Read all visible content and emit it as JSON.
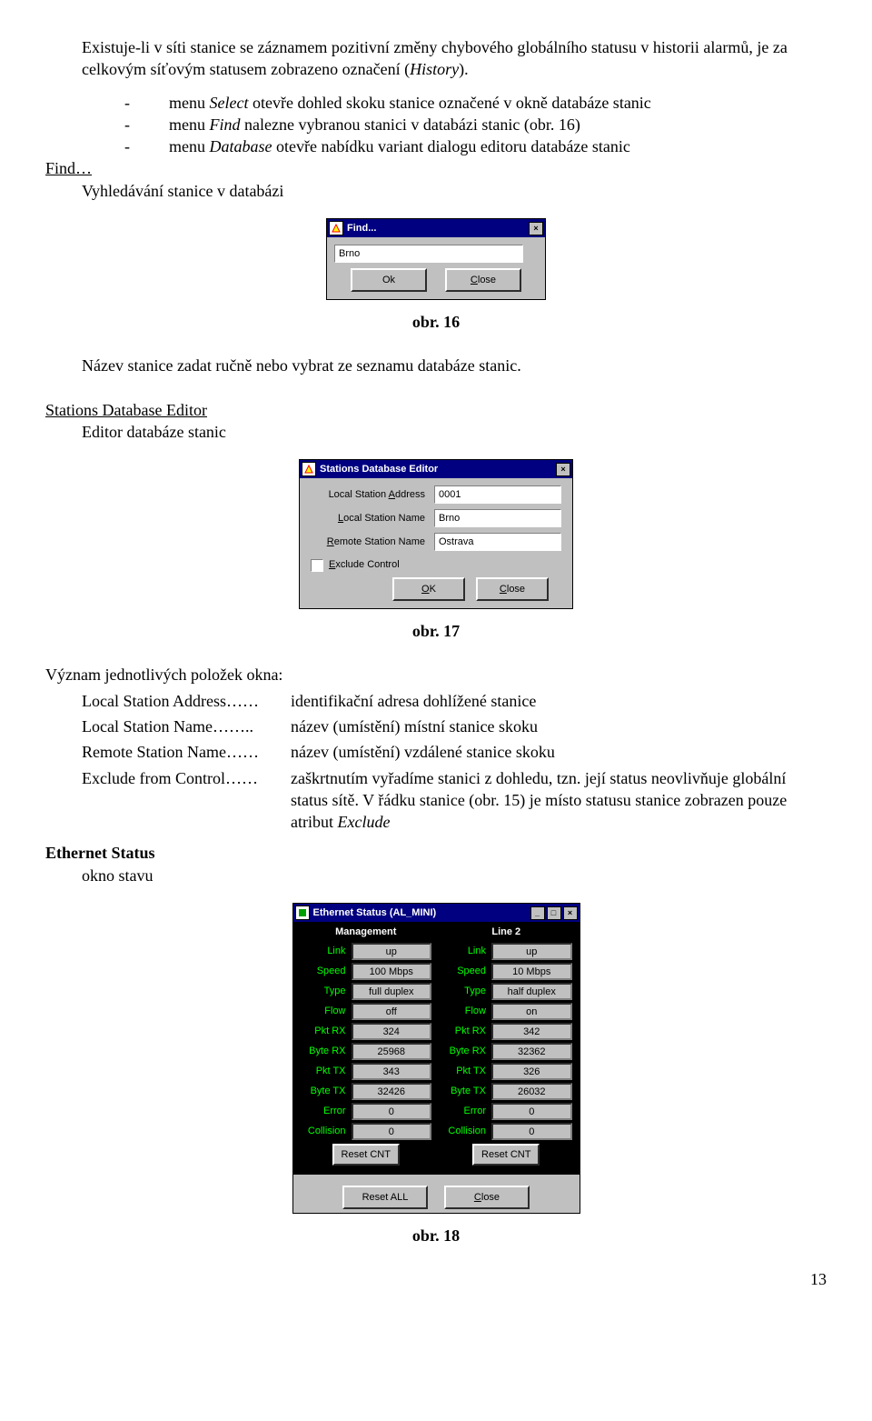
{
  "para1_a": "Existuje-li v síti stanice se záznamem pozitivní změny chybového globálního statusu v historii alarmů, je za celkovým síťovým statusem zobrazeno označení (",
  "para1_b": "History",
  "para1_c": ").",
  "bullets": {
    "sel_a": "menu ",
    "sel_i": "Select",
    "sel_b": " otevře dohled skoku stanice označené v okně databáze stanic",
    "find_a": "menu ",
    "find_i": "Find",
    "find_b": " nalezne vybranou stanici v databázi stanic (obr. 16)",
    "db_a": "menu ",
    "db_i": "Database",
    "db_b": " otevře nabídku variant dialogu editoru databáze stanic"
  },
  "find_heading": "Find…",
  "find_sub": "Vyhledávání stanice v databázi",
  "findDialog": {
    "title": "Find...",
    "value": "Brno",
    "ok": "Ok",
    "close": "Close",
    "close_u": "C"
  },
  "cap16": "obr. 16",
  "afterFind": "Název stanice zadat ručně nebo vybrat ze seznamu databáze stanic.",
  "sdeHeading": "Stations Database Editor",
  "sdeSub": "Editor databáze stanic",
  "sde": {
    "title": "Stations Database Editor",
    "f1": "Local Station Address",
    "v1": "0001",
    "f2": "Local Station Name",
    "v2": "Brno",
    "f3": "Remote Station Name",
    "v3": "Ostrava",
    "f4": "Exclude Control",
    "ok": "OK",
    "ok_u": "O",
    "close": "Close",
    "close_u": "C",
    "lblL": "L",
    "lblE": "E",
    "lblR": "R"
  },
  "cap17": "obr. 17",
  "meaningTitle": "Význam jednotlivých položek okna:",
  "meaning": {
    "r1l": "Local Station Address……",
    "r1v": "identifikační adresa dohlížené stanice",
    "r2l": "Local Station Name……..",
    "r2v": "název (umístění) místní stanice skoku",
    "r3l": "Remote Station Name……",
    "r3v": "název (umístění) vzdálené stanice skoku",
    "r4l": "Exclude from Control……",
    "r4va": "zaškrtnutím vyřadíme stanici z dohledu, tzn. její status neovlivňuje globální status sítě. V řádku stanice (obr. 15) je místo statusu stanice zobrazen pouze atribut ",
    "r4vb": "Exclude"
  },
  "ethHeading": "Ethernet Status",
  "ethSub": "okno stavu",
  "eth": {
    "title": "Ethernet Status (AL_MINI)",
    "col1": "Management",
    "col2": "Line 2",
    "labels": {
      "link": "Link",
      "speed": "Speed",
      "type": "Type",
      "flow": "Flow",
      "pktrx": "Pkt RX",
      "byterx": "Byte RX",
      "pkttx": "Pkt TX",
      "bytetx": "Byte TX",
      "error": "Error",
      "coll": "Collision"
    },
    "c1": {
      "link": "up",
      "speed": "100 Mbps",
      "type": "full duplex",
      "flow": "off",
      "pktrx": "324",
      "byterx": "25968",
      "pkttx": "343",
      "bytetx": "32426",
      "error": "0",
      "coll": "0"
    },
    "c2": {
      "link": "up",
      "speed": "10 Mbps",
      "type": "half duplex",
      "flow": "on",
      "pktrx": "342",
      "byterx": "32362",
      "pkttx": "326",
      "bytetx": "26032",
      "error": "0",
      "coll": "0"
    },
    "resetcnt": "Reset CNT",
    "resetall": "Reset ALL",
    "close": "Close",
    "close_u": "C"
  },
  "cap18": "obr. 18",
  "pageNum": "13",
  "dash": "-"
}
